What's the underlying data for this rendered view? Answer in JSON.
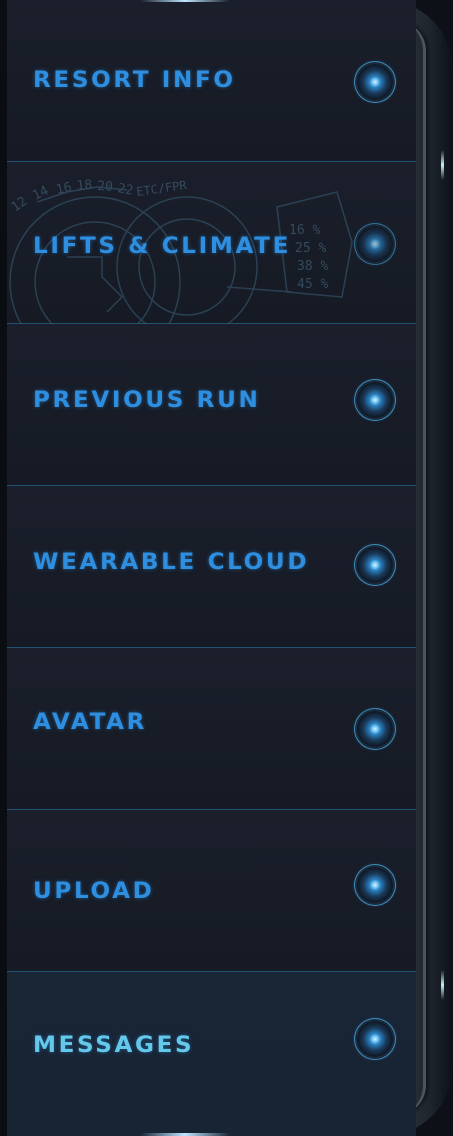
{
  "menu": {
    "items": [
      {
        "label": "Resort Info"
      },
      {
        "label": "Lifts & Climate"
      },
      {
        "label": "Previous Run"
      },
      {
        "label": "Wearable Cloud"
      },
      {
        "label": "Avatar"
      },
      {
        "label": "Upload"
      },
      {
        "label": "Messages"
      }
    ],
    "active_index": 6
  },
  "decoration": {
    "dial_ticks": [
      "12",
      "14",
      "16",
      "18",
      "20",
      "22"
    ],
    "dial_text": "ETC/FPR",
    "percents": [
      "16 %",
      "25 %",
      "38 %",
      "45 %"
    ]
  },
  "colors": {
    "label": "#2e8ee0",
    "active_label": "#63c8ea",
    "divider": "#1f5370",
    "knob": "#3c8dbf"
  }
}
